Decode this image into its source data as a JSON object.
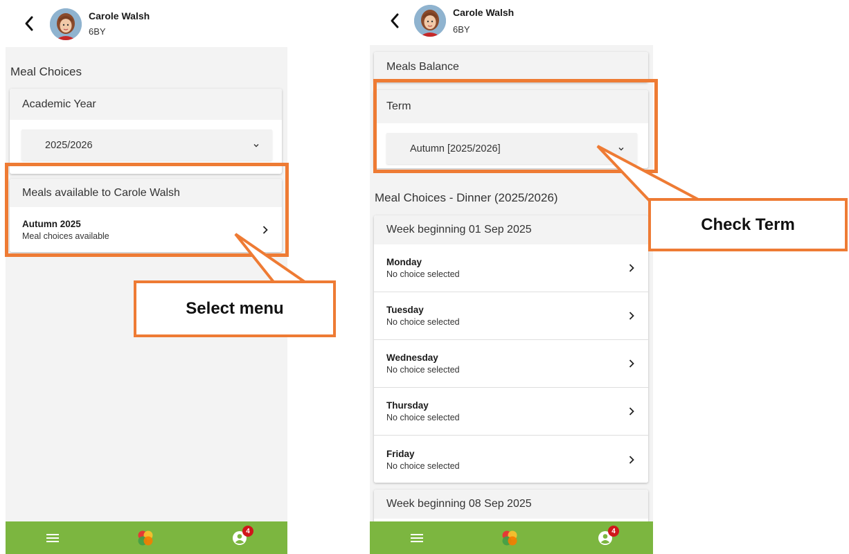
{
  "student": {
    "name": "Carole Walsh",
    "class": "6BY"
  },
  "left_screen": {
    "section_title": "Meal Choices",
    "academic_year_card": {
      "header": "Academic Year",
      "selected_year": "2025/2026"
    },
    "meals_card": {
      "header": "Meals available to Carole Walsh",
      "items": [
        {
          "title": "Autumn 2025",
          "subtitle": "Meal choices available"
        }
      ]
    }
  },
  "right_screen": {
    "balance_label": "Meals Balance",
    "term_card": {
      "header": "Term",
      "selected_term": "Autumn [2025/2026]"
    },
    "section_title": "Meal Choices - Dinner (2025/2026)",
    "weeks": [
      {
        "header": "Week beginning 01 Sep 2025",
        "days": [
          {
            "title": "Monday",
            "subtitle": "No choice selected"
          },
          {
            "title": "Tuesday",
            "subtitle": "No choice selected"
          },
          {
            "title": "Wednesday",
            "subtitle": "No choice selected"
          },
          {
            "title": "Thursday",
            "subtitle": "No choice selected"
          },
          {
            "title": "Friday",
            "subtitle": "No choice selected"
          }
        ]
      },
      {
        "header": "Week beginning 08 Sep 2025"
      }
    ]
  },
  "bottom_nav": {
    "notification_count": "4"
  },
  "annotations": {
    "select_menu": "Select menu",
    "check_term": "Check Term"
  },
  "icons": {
    "back": "chevron-left-icon",
    "menu": "hamburger-menu-icon",
    "logo": "app-logo-icon",
    "profile": "user-profile-icon",
    "chevron_down": "chevron-down-icon",
    "chevron_right": "chevron-right-icon"
  },
  "colors": {
    "nav_bar": "#7cb640",
    "annotation": "#ee7b34",
    "badge": "#d0161b",
    "content_bg": "#f3f3f3"
  }
}
